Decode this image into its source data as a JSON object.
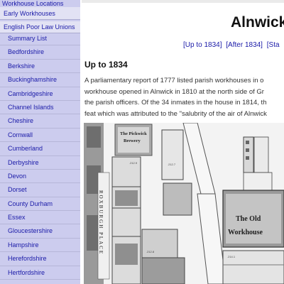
{
  "sidebar": {
    "top_label": "Workhouse Locations",
    "sections": [
      "Early Workhouses",
      "English Poor Law Unions"
    ],
    "items": [
      "Summary List",
      "Bedfordshire",
      "Berkshire",
      "Buckinghamshire",
      "Cambridgeshire",
      "Channel Islands",
      "Cheshire",
      "Cornwall",
      "Cumberland",
      "Derbyshire",
      "Devon",
      "Dorset",
      "County Durham",
      "Essex",
      "Gloucestershire",
      "Hampshire",
      "Herefordshire",
      "Hertfordshire"
    ]
  },
  "main": {
    "title": "Alnwick,",
    "nav_links": [
      "[Up to 1834]",
      "[After 1834]",
      "[Sta"
    ],
    "section_heading": "Up to 1834",
    "paragraph_lines": [
      "A parliamentary report of 1777 listed parish workhouses in o",
      "workhouse opened in Alnwick in 1810 at the north side of Gr",
      "the parish officers. Of the 34 inmates in the house in 1814, th",
      "feat which was attributed to the \"salubrity of the air of Alnwick"
    ],
    "map_labels": {
      "pickwick": "The Pickwick",
      "brewery": "Brewery",
      "old": "The Old",
      "workhouse": "Workhouse",
      "street": "ROXBURGH  PLACE"
    }
  },
  "colors": {
    "sidebar_bg": "#ccccee",
    "link": "#1a1aa8"
  }
}
